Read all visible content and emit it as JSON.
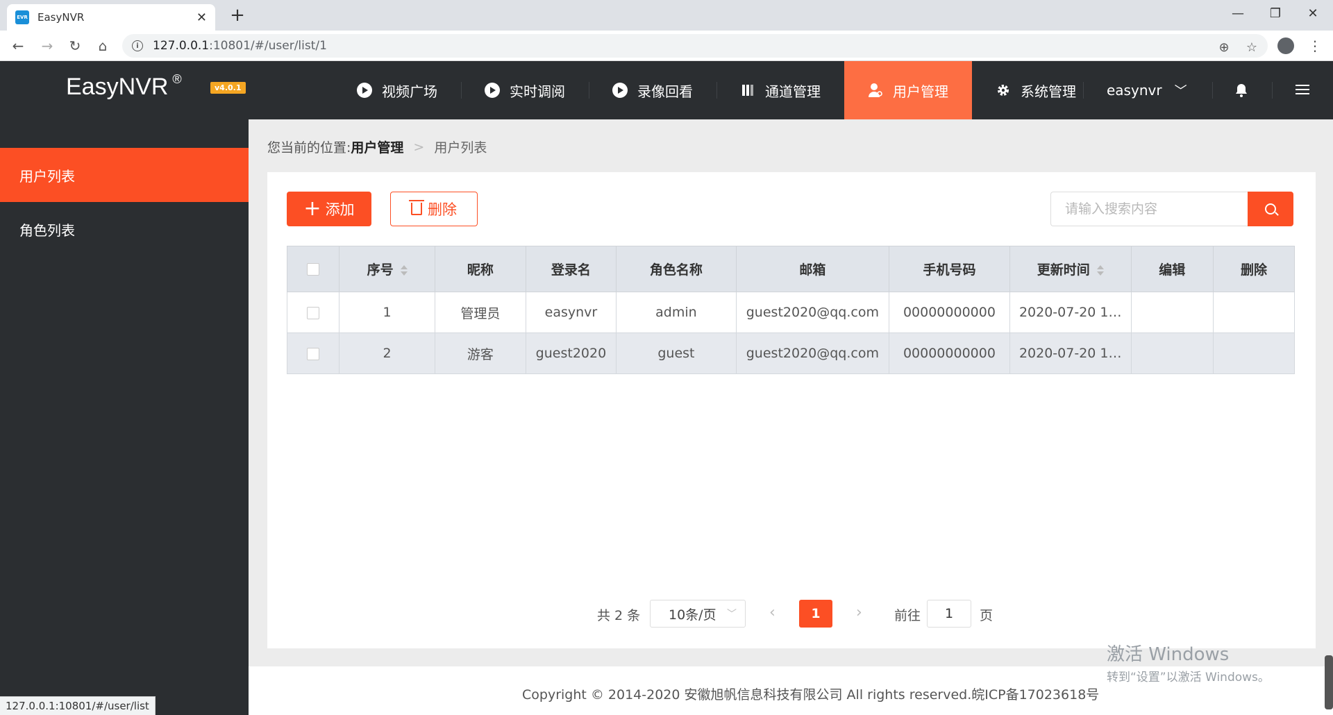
{
  "browser": {
    "tab_title": "EasyNVR",
    "favicon_text": "EVR",
    "url_host": "127.0.0.1",
    "url_rest": ":10801/#/user/list/1",
    "status_url": "127.0.0.1:10801/#/user/list"
  },
  "header": {
    "brand": "EasyNVR",
    "brand_mark": "®",
    "version": "v4.0.1",
    "nav": [
      {
        "label": "视频广场",
        "icon": "play-circle-icon"
      },
      {
        "label": "实时调阅",
        "icon": "play-circle-icon"
      },
      {
        "label": "录像回看",
        "icon": "play-circle-icon"
      },
      {
        "label": "通道管理",
        "icon": "channel-icon"
      },
      {
        "label": "用户管理",
        "icon": "user-icon"
      },
      {
        "label": "系统管理",
        "icon": "gear-icon"
      }
    ],
    "user_name": "easynvr"
  },
  "sidebar": {
    "items": [
      {
        "label": "用户列表"
      },
      {
        "label": "角色列表"
      }
    ]
  },
  "breadcrumb": {
    "prefix": "您当前的位置:",
    "section": "用户管理",
    "current": "用户列表"
  },
  "toolbar": {
    "add_label": "添加",
    "delete_label": "删除",
    "search_placeholder": "请输入搜索内容"
  },
  "table": {
    "columns": [
      "序号",
      "昵称",
      "登录名",
      "角色名称",
      "邮箱",
      "手机号码",
      "更新时间",
      "编辑",
      "删除"
    ],
    "rows": [
      {
        "no": "1",
        "nickname": "管理员",
        "login": "easynvr",
        "role": "admin",
        "email": "guest2020@qq.com",
        "phone": "00000000000",
        "updated": "2020-07-20 1…"
      },
      {
        "no": "2",
        "nickname": "游客",
        "login": "guest2020",
        "role": "guest",
        "email": "guest2020@qq.com",
        "phone": "00000000000",
        "updated": "2020-07-20 1…"
      }
    ]
  },
  "pagination": {
    "total_label": "共 2 条",
    "page_size": "10条/页",
    "current_page": "1",
    "goto_label": "前往",
    "goto_value": "1",
    "page_unit": "页"
  },
  "footer": {
    "copyright": "Copyright © 2014-2020 安徽旭帆信息科技有限公司 All rights reserved.皖ICP备17023618号"
  },
  "watermark": {
    "line1": "激活 Windows",
    "line2": "转到“设置”以激活 Windows。"
  },
  "colors": {
    "accent": "#fc4f24",
    "nav_active": "#fd6e43",
    "header_bg": "#2b2e31"
  }
}
